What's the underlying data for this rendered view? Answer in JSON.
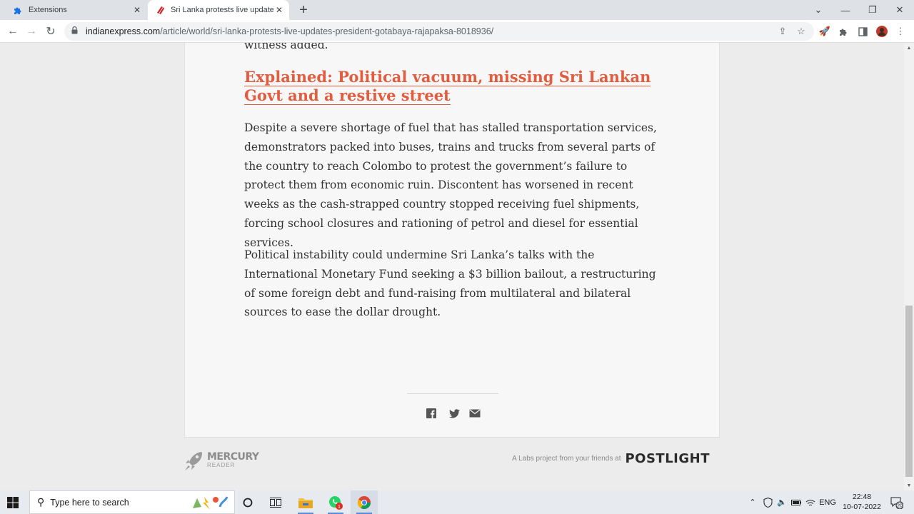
{
  "browser": {
    "tabs": [
      {
        "title": "Extensions",
        "icon": "puzzle-icon",
        "active": false
      },
      {
        "title": "Sri Lanka protests live updates: C",
        "icon": "indianexpress-icon",
        "active": true
      }
    ],
    "url_domain": "indianexpress.com",
    "url_path": "/article/world/sri-lanka-protests-live-updates-president-gotabaya-rajapaksa-8018936/"
  },
  "article": {
    "tail_text": "witness added.",
    "headline": "Explained: Political vacuum, missing Sri Lankan Govt and a restive street",
    "paragraphs": [
      "Despite a severe shortage of fuel that has stalled transportation services, demonstrators packed into buses, trains and trucks from several parts of the country to reach Colombo to protest the government’s failure to protect them from economic ruin. Discontent has worsened in recent weeks as the cash-strapped country stopped receiving fuel shipments, forcing school closures and rationing of petrol and diesel for essential services.",
      "Political instability could undermine Sri Lanka’s talks with the International Monetary Fund seeking a $3 billion bailout, a restructuring of some foreign debt and fund-raising from multilateral and bilateral sources to ease the dollar drought."
    ],
    "share_icons": [
      "facebook-icon",
      "twitter-icon",
      "email-icon"
    ]
  },
  "footer": {
    "mercury_name": "MERCURY",
    "mercury_sub": "READER",
    "labs_text": "A Labs project from your friends at",
    "postlight": "POSTLIGHT"
  },
  "taskbar": {
    "search_placeholder": "Type here to search",
    "language": "ENG",
    "time": "22:48",
    "date": "10-07-2022",
    "notification_count": "20",
    "whatsapp_badge": "1"
  },
  "colors": {
    "headline": "#e25d3f",
    "body_text": "#333333",
    "page_bg": "#ececec",
    "article_bg": "#f7f7f7"
  }
}
